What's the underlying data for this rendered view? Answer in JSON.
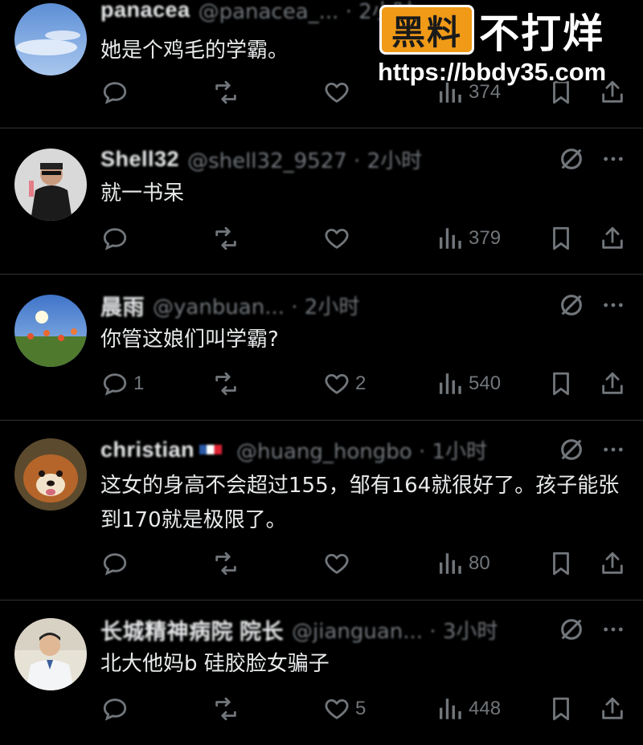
{
  "posts": [
    {
      "name": "panacea",
      "meta": "@panacea_... · 2小时",
      "text": "她是个鸡毛的学霸。",
      "replies": "",
      "reposts": "",
      "likes": "",
      "views": "374"
    },
    {
      "name": "Shell32",
      "meta": "@shell32_9527 · 2小时",
      "text": "就一书呆",
      "replies": "",
      "reposts": "",
      "likes": "",
      "views": "379"
    },
    {
      "name": "晨雨",
      "meta": "@yanbuan... · 2小时",
      "text": "你管这娘们叫学霸?",
      "replies": "1",
      "reposts": "",
      "likes": "2",
      "views": "540"
    },
    {
      "name": "christian",
      "meta": "@huang_hongbo · 1小时",
      "text": "这女的身高不会超过155，邹有164就很好了。孩子能张到170就是极限了。",
      "replies": "",
      "reposts": "",
      "likes": "",
      "views": "80"
    },
    {
      "name": "长城精神病院 院长",
      "meta": "@jianguan... · 3小时",
      "text": "北大他妈b 硅胶脸女骗子",
      "replies": "",
      "reposts": "",
      "likes": "5",
      "views": "448"
    }
  ],
  "watermark": {
    "badge": "黑料",
    "title": "不打烊",
    "url": "https://bbdy35.com"
  },
  "colors": {
    "background": "#000000",
    "text": "#e7e9ea",
    "muted": "#71767b",
    "divider": "#2f3336",
    "badge": "#f09a18"
  },
  "icons": [
    "reply-icon",
    "repost-icon",
    "like-icon",
    "views-icon",
    "bookmark-icon",
    "share-icon",
    "mute-icon",
    "more-icon"
  ]
}
